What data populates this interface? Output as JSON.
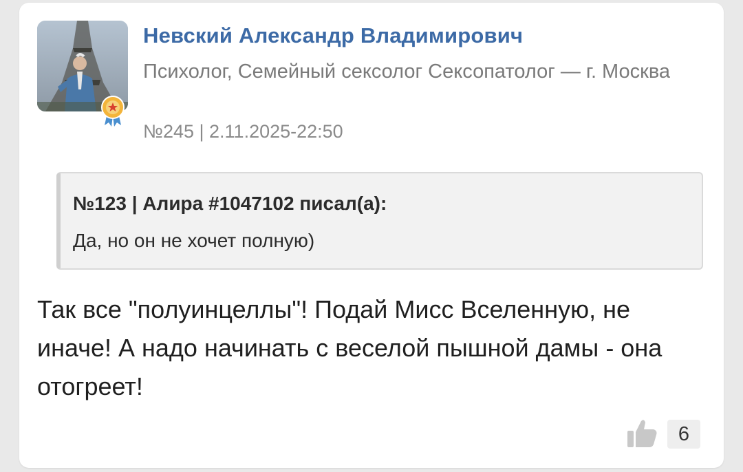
{
  "post": {
    "author_name": "Невский Александр Владимирович",
    "author_role": "Психолог, Семейный сексолог Сексопатолог — г. Москва",
    "meta": "№245 | 2.11.2025-22:50",
    "quote": {
      "header": "№123 | Алира #1047102 писал(а):",
      "text": "Да, но он не хочет полную)"
    },
    "text": "Так все \"полуинцеллы\"! Подай Мисс Вселенную, не иначе! А надо начинать с веселой пышной дамы - она отогреет!",
    "likes": "6"
  },
  "icons": {
    "avatar": "author-photo",
    "badge": "award-badge-icon",
    "like": "thumbs-up-icon"
  },
  "colors": {
    "author_link": "#3c6aa6",
    "secondary_text": "#7a7a7a",
    "quote_background": "#f2f2f2",
    "page_background": "#e9e9e9"
  }
}
